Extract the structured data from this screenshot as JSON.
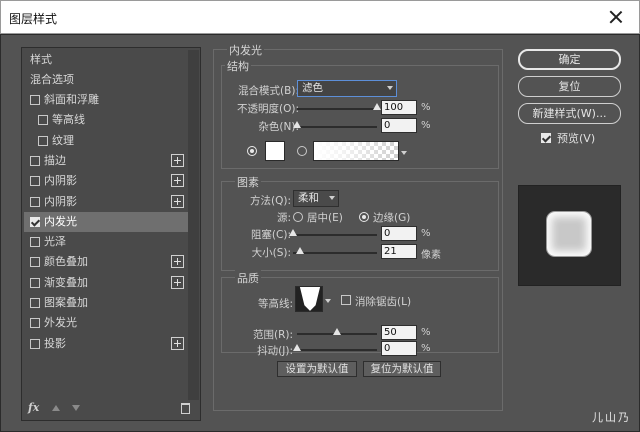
{
  "window": {
    "title": "图层样式"
  },
  "styles_list": {
    "header": "样式",
    "blending_options": "混合选项",
    "items": [
      {
        "label": "斜面和浮雕",
        "checked": false,
        "indent": false,
        "plus": false
      },
      {
        "label": "等高线",
        "checked": false,
        "indent": true,
        "plus": false
      },
      {
        "label": "纹理",
        "checked": false,
        "indent": true,
        "plus": false
      },
      {
        "label": "描边",
        "checked": false,
        "indent": false,
        "plus": true
      },
      {
        "label": "内阴影",
        "checked": false,
        "indent": false,
        "plus": true
      },
      {
        "label": "内阴影",
        "checked": false,
        "indent": false,
        "plus": true
      },
      {
        "label": "内发光",
        "checked": true,
        "indent": false,
        "plus": false,
        "selected": true
      },
      {
        "label": "光泽",
        "checked": false,
        "indent": false,
        "plus": false
      },
      {
        "label": "颜色叠加",
        "checked": false,
        "indent": false,
        "plus": true
      },
      {
        "label": "渐变叠加",
        "checked": false,
        "indent": false,
        "plus": true
      },
      {
        "label": "图案叠加",
        "checked": false,
        "indent": false,
        "plus": false
      },
      {
        "label": "外发光",
        "checked": false,
        "indent": false,
        "plus": false
      },
      {
        "label": "投影",
        "checked": false,
        "indent": false,
        "plus": true
      }
    ],
    "footer": {
      "fx_label": "fx",
      "icons": [
        "fx-icon",
        "move-up-icon",
        "move-down-icon",
        "trash-icon"
      ]
    }
  },
  "inner_glow": {
    "section_title": "内发光",
    "structure": {
      "title": "结构",
      "blend_mode_label": "混合模式(B):",
      "blend_mode_value": "滤色",
      "opacity_label": "不透明度(O):",
      "opacity_value": "100",
      "opacity_unit": "%",
      "opacity_fraction": 1.0,
      "noise_label": "杂色(N):",
      "noise_value": "0",
      "noise_unit": "%",
      "noise_fraction": 0.0,
      "glow_color": "#ffffff",
      "color_mode": "solid"
    },
    "elements": {
      "title": "图素",
      "technique_label": "方法(Q):",
      "technique_value": "柔和",
      "source_label": "源:",
      "source_center": "居中(E)",
      "source_edge": "边缘(G)",
      "source_selected": "edge",
      "choke_label": "阻塞(C):",
      "choke_value": "0",
      "choke_unit": "%",
      "choke_fraction": 0.0,
      "size_label": "大小(S):",
      "size_value": "21",
      "size_unit": "像素",
      "size_fraction": 0.084
    },
    "quality": {
      "title": "品质",
      "contour_label": "等高线:",
      "anti_alias_label": "消除锯齿(L)",
      "anti_alias_checked": false,
      "range_label": "范围(R):",
      "range_value": "50",
      "range_unit": "%",
      "range_fraction": 0.5,
      "jitter_label": "抖动(J):",
      "jitter_value": "0",
      "jitter_unit": "%",
      "jitter_fraction": 0.0
    },
    "buttons": {
      "make_default": "设置为默认值",
      "reset_default": "复位为默认值"
    }
  },
  "actions": {
    "ok": "确定",
    "reset": "复位",
    "new_style": "新建样式(W)...",
    "preview_label": "预览(V)",
    "preview_checked": true
  },
  "watermark": "儿山乃"
}
